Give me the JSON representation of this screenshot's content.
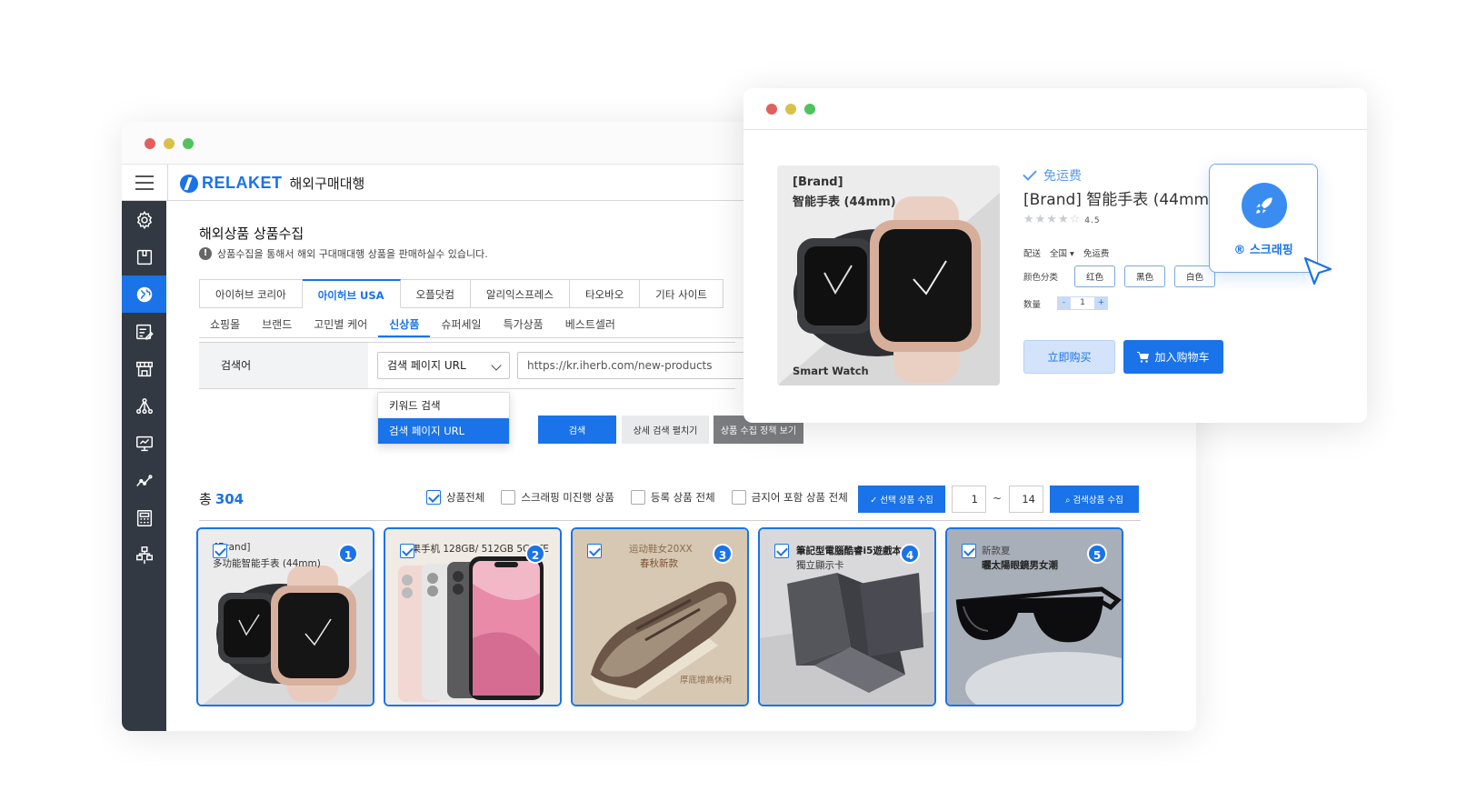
{
  "app": {
    "brand": "RELAKET",
    "brand_sub": "해외구매대행",
    "page_title": "해외상품 상품수집",
    "page_desc": "상품수집을 통해서 해외 구대매대행 상품을 판매하실수 있습니다.",
    "info_icon": "!"
  },
  "sidebar": {
    "items": [
      {
        "icon": "gear-icon",
        "active": false
      },
      {
        "icon": "box-icon",
        "active": false
      },
      {
        "icon": "globe-icon",
        "active": true
      },
      {
        "icon": "edit-list-icon",
        "active": false
      },
      {
        "icon": "store-icon",
        "active": false
      },
      {
        "icon": "network-icon",
        "active": false
      },
      {
        "icon": "monitor-icon",
        "active": false
      },
      {
        "icon": "trend-icon",
        "active": false
      },
      {
        "icon": "calculator-icon",
        "active": false
      },
      {
        "icon": "hierarchy-icon",
        "active": false
      }
    ]
  },
  "tabs": [
    {
      "label": "아이허브 코리아",
      "active": false
    },
    {
      "label": "아이허브 USA",
      "active": true
    },
    {
      "label": "오플닷컴",
      "active": false
    },
    {
      "label": "알리익스프레스",
      "active": false
    },
    {
      "label": "타오바오",
      "active": false
    },
    {
      "label": "기타 사이트",
      "active": false
    }
  ],
  "subtabs": [
    {
      "label": "쇼핑몰",
      "active": false
    },
    {
      "label": "브랜드",
      "active": false
    },
    {
      "label": "고민별 케어",
      "active": false
    },
    {
      "label": "신상품",
      "active": true
    },
    {
      "label": "슈퍼세일",
      "active": false
    },
    {
      "label": "특가상품",
      "active": false
    },
    {
      "label": "베스트셀러",
      "active": false
    }
  ],
  "search": {
    "label": "검색어",
    "select_value": "검색 페이지 URL",
    "url_value": "https://kr.iherb.com/new-products",
    "dropdown_options": [
      {
        "label": "키워드 검색",
        "selected": false
      },
      {
        "label": "검색 페이지 URL",
        "selected": true
      }
    ],
    "search_button": "검색",
    "detail_button": "상세 검색 펼치기",
    "policy_button": "상품 수집 정책 보기"
  },
  "results": {
    "total_label": "총",
    "total_count": "304",
    "filters": [
      {
        "label": "상품전체",
        "checked": true
      },
      {
        "label": "스크래핑 미진행 상품",
        "checked": false
      },
      {
        "label": "등록 상품 전체",
        "checked": false
      },
      {
        "label": "금지어 포함 상품 전체",
        "checked": false
      }
    ],
    "collect_selected": "선택 상품 수집",
    "range_from": "1",
    "range_sep": "~",
    "range_to": "14",
    "collect_search": "검색상품 수집"
  },
  "products": [
    {
      "num": "1",
      "cap1": "[Brand]",
      "cap2": "多功能智能手表 (44mm)"
    },
    {
      "num": "2",
      "cap1": "苹果手机 128GB/ 512GB 5G LTE",
      "cap2": ""
    },
    {
      "num": "3",
      "cap1": "运动鞋女20XX",
      "cap2": "春秋新款",
      "cap3": "厚底增高休闲"
    },
    {
      "num": "4",
      "cap1": "筆記型電腦酷睿i5遊戲本",
      "cap2": "獨立顯示卡"
    },
    {
      "num": "5",
      "cap1": "新款夏",
      "cap2": "曬太陽眼鏡男女潮"
    }
  ],
  "popup": {
    "img_brand": "[Brand]",
    "img_title": "智能手表 (44mm)",
    "img_caption": "Smart Watch",
    "free_ship": "免运费",
    "title": "[Brand] 智能手表 (44mm)",
    "stars": "★★★★☆",
    "rating": "4.5",
    "ship_label": "配送",
    "ship_region": "全国 ▾",
    "ship_value": "免运费",
    "color_label": "颜色分类",
    "colors": [
      "红色",
      "黑色",
      "白色"
    ],
    "qty_label": "数量",
    "qty_minus": "-",
    "qty_value": "1",
    "qty_plus": "+",
    "buy_now": "立即购买",
    "add_cart": "加入购物车"
  },
  "scrape": {
    "label": "® 스크래핑"
  },
  "colors": {
    "accent": "#1a73e8",
    "sidebar_bg": "#323942"
  }
}
